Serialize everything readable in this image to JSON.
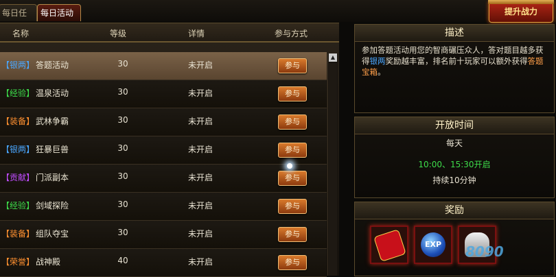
{
  "tabs": {
    "daily_tasks": "每日任务",
    "daily_events": "每日活动"
  },
  "boost_button": "提升战力",
  "table": {
    "headers": {
      "name": "名称",
      "level": "等级",
      "details": "详情",
      "join": "参与方式"
    },
    "rows": [
      {
        "category": "【银两】",
        "category_color": "#4aa7ff",
        "name": "答题活动",
        "level": "30",
        "status": "未开启",
        "action": "参与"
      },
      {
        "category": "【经验】",
        "category_color": "#3ddc4a",
        "name": "温泉活动",
        "level": "30",
        "status": "未开启",
        "action": "参与"
      },
      {
        "category": "【装备】",
        "category_color": "#ff9030",
        "name": "武林争霸",
        "level": "30",
        "status": "未开启",
        "action": "参与"
      },
      {
        "category": "【银两】",
        "category_color": "#4aa7ff",
        "name": "狂暴巨兽",
        "level": "30",
        "status": "未开启",
        "action": "参与"
      },
      {
        "category": "【贡献】",
        "category_color": "#c04cff",
        "name": "门派副本",
        "level": "30",
        "status": "未开启",
        "action": "参与"
      },
      {
        "category": "【经验】",
        "category_color": "#3ddc4a",
        "name": "剑域探险",
        "level": "30",
        "status": "未开启",
        "action": "参与"
      },
      {
        "category": "【装备】",
        "category_color": "#ff9030",
        "name": "组队夺宝",
        "level": "30",
        "status": "未开启",
        "action": "参与"
      },
      {
        "category": "【荣誉】",
        "category_color": "#ff9030",
        "name": "战神殿",
        "level": "40",
        "status": "未开启",
        "action": "参与"
      }
    ]
  },
  "description": {
    "title": "描述",
    "text_1": "参加答题活动用您的智商碾压众人，答对题目越多获得",
    "silver": "银两",
    "text_2": "奖励越丰富，排名前十玩家可以额外获得",
    "chest": "答题宝箱",
    "text_3": "。"
  },
  "open_time": {
    "title": "开放时间",
    "frequency": "每天",
    "times": "10:00、15:30开启",
    "duration": "持续10分钟"
  },
  "reward": {
    "title": "奖励",
    "items": [
      "red-envelope-icon",
      "exp-orb-icon",
      "silver-ingot-icon"
    ]
  },
  "watermark": "8090"
}
